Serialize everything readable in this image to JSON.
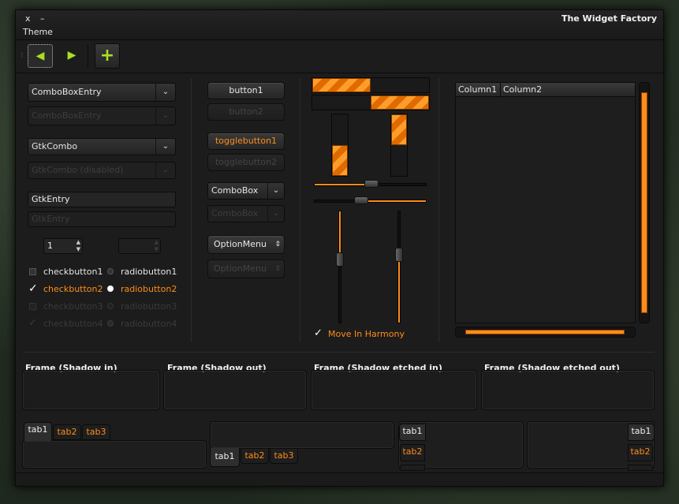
{
  "window": {
    "title": "The Widget Factory",
    "close": "x",
    "minimize": "–",
    "menu": "Theme"
  },
  "toolbar": {
    "back": "◀",
    "forward": "▶",
    "add": "+"
  },
  "left": {
    "combo_entry": "ComboBoxEntry",
    "combo_entry_dis": "ComboBoxEntry",
    "gtk_combo": "GtkCombo",
    "gtk_combo_dis": "GtkCombo (disabled)",
    "entry": "GtkEntry",
    "entry_dis": "GtkEntry",
    "spin": "1",
    "spin_dis": "",
    "check1": "checkbutton1",
    "check2": "checkbutton2",
    "check3": "checkbutton3",
    "check4": "checkbutton4",
    "radio1": "radiobutton1",
    "radio2": "radiobutton2",
    "radio3": "radiobutton3",
    "radio4": "radiobutton4"
  },
  "middle": {
    "button1": "button1",
    "button2": "button2",
    "toggle1": "togglebutton1",
    "toggle2": "togglebutton2",
    "combobox": "ComboBox",
    "combobox_dis": "ComboBox",
    "optionmenu": "OptionMenu",
    "optionmenu_dis": "OptionMenu"
  },
  "range": {
    "harmony": "Move In Harmony",
    "progress_h1": 0.5,
    "progress_v1": 0.5,
    "slider": 0.52
  },
  "tree": {
    "col1": "Column1",
    "col2": "Column2"
  },
  "frames": [
    "Frame (Shadow in)",
    "Frame (Shadow out)",
    "Frame (Shadow etched in)",
    "Frame (Shadow etched out)"
  ],
  "tabs": {
    "t1": "tab1",
    "t2": "tab2",
    "t3": "tab3"
  }
}
